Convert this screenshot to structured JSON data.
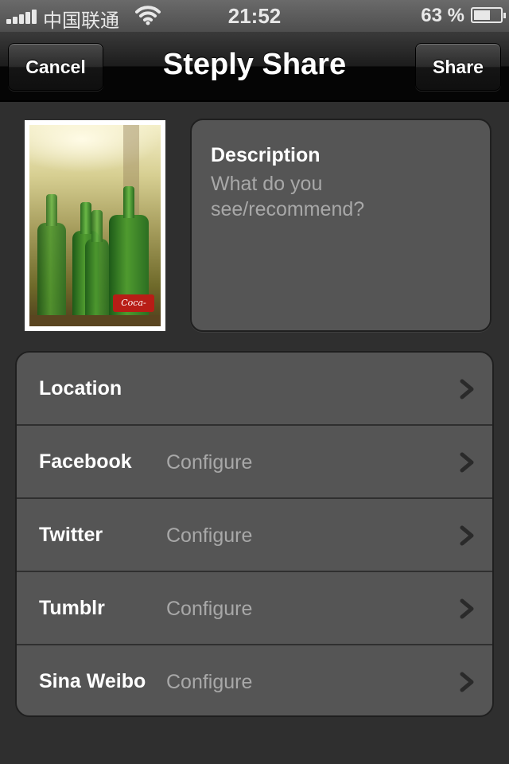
{
  "status_bar": {
    "carrier": "中国联通",
    "time": "21:52",
    "battery_percent_text": "63 %",
    "battery_level": 0.63
  },
  "nav": {
    "title": "Steply Share",
    "cancel_label": "Cancel",
    "share_label": "Share"
  },
  "description": {
    "title": "Description",
    "placeholder": "What do you see/recommend?"
  },
  "settings": {
    "rows": [
      {
        "label": "Location",
        "value": ""
      },
      {
        "label": "Facebook",
        "value": "Configure"
      },
      {
        "label": "Twitter",
        "value": "Configure"
      },
      {
        "label": "Tumblr",
        "value": "Configure"
      },
      {
        "label": "Sina Weibo",
        "value": "Configure"
      }
    ]
  },
  "icons": {
    "signal": "signal-bars-icon",
    "wifi": "wifi-icon",
    "battery": "battery-icon",
    "chevron": "chevron-right-icon"
  },
  "colors": {
    "background": "#2f2f2f",
    "cell": "#555555",
    "secondary_text": "#a8a8a8",
    "nav_bar": "#0a0a0a"
  }
}
